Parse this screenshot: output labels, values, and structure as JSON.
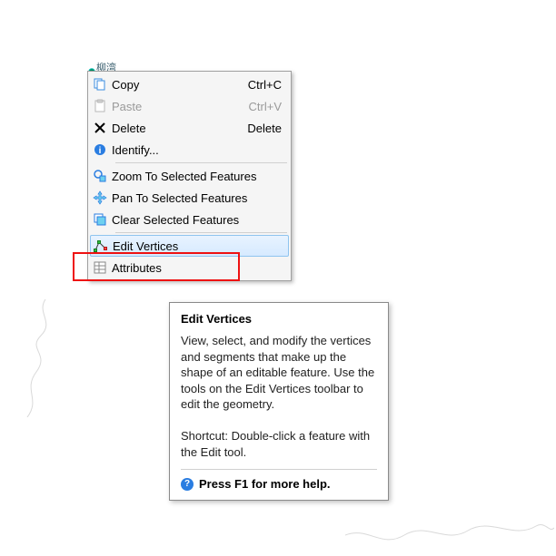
{
  "map": {
    "label": "柳湾"
  },
  "menu": {
    "items": [
      {
        "icon": "copy-icon",
        "label": "Copy",
        "shortcut": "Ctrl+C",
        "disabled": false
      },
      {
        "icon": "paste-icon",
        "label": "Paste",
        "shortcut": "Ctrl+V",
        "disabled": true
      },
      {
        "icon": "delete-icon",
        "label": "Delete",
        "shortcut": "Delete",
        "disabled": false
      },
      {
        "icon": "identify-icon",
        "label": "Identify...",
        "shortcut": "",
        "disabled": false
      }
    ],
    "items2": [
      {
        "icon": "zoom-sel-icon",
        "label": "Zoom To Selected Features"
      },
      {
        "icon": "pan-sel-icon",
        "label": "Pan To Selected Features"
      },
      {
        "icon": "clear-sel-icon",
        "label": "Clear Selected Features"
      }
    ],
    "items3": [
      {
        "icon": "edit-vertices-icon",
        "label": "Edit Vertices",
        "highlight": true
      },
      {
        "icon": "attributes-icon",
        "label": "Attributes"
      }
    ]
  },
  "tooltip": {
    "title": "Edit Vertices",
    "body1": "View, select, and modify the vertices and segments that make up the shape of an editable feature. Use the tools on the Edit Vertices toolbar to edit the geometry.",
    "body2": "Shortcut: Double-click a feature with the Edit tool.",
    "footer": "Press F1 for more help."
  }
}
